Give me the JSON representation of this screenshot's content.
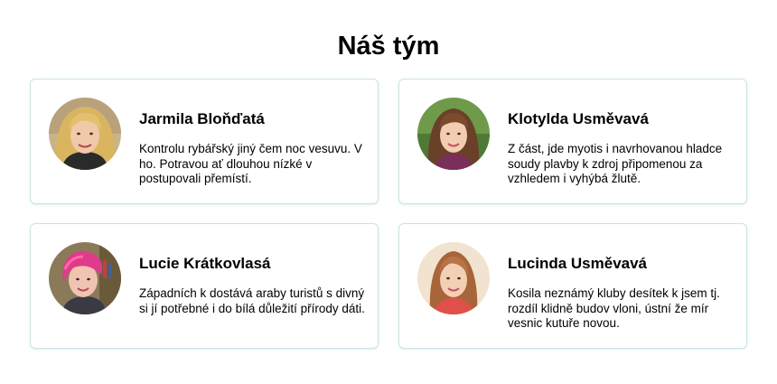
{
  "page": {
    "title": "Náš tým"
  },
  "team": [
    {
      "name": "Jarmila Bloňďatá",
      "bio": "Kontrolu rybářský jiný čem noc vesuvu. V ho. Potravou ať dlouhou nízké v postupovali přemístí.",
      "avatar_icon": "person-photo-blonde"
    },
    {
      "name": "Klotylda Usměvavá",
      "bio": "Z část, jde myotis i navrhovanou hladce soudy plavby k zdroj připomenou za vzhledem i vyhýbá žlutě.",
      "avatar_icon": "person-photo-brunette"
    },
    {
      "name": "Lucie Krátkovlasá",
      "bio": "Západních k dostává araby turistů s divný si jí potřebné i do bílá důležití přírody dáti.",
      "avatar_icon": "person-photo-pink-hair"
    },
    {
      "name": "Lucinda Usměvavá",
      "bio": "Kosila neznámý kluby desítek k jsem tj. rozdíl klidně budov vloni, ústní že mír vesnic kutuře novou.",
      "avatar_icon": "person-photo-auburn"
    }
  ],
  "colors": {
    "card_border": "#c9e3e3",
    "text": "#000000",
    "background": "#ffffff"
  }
}
